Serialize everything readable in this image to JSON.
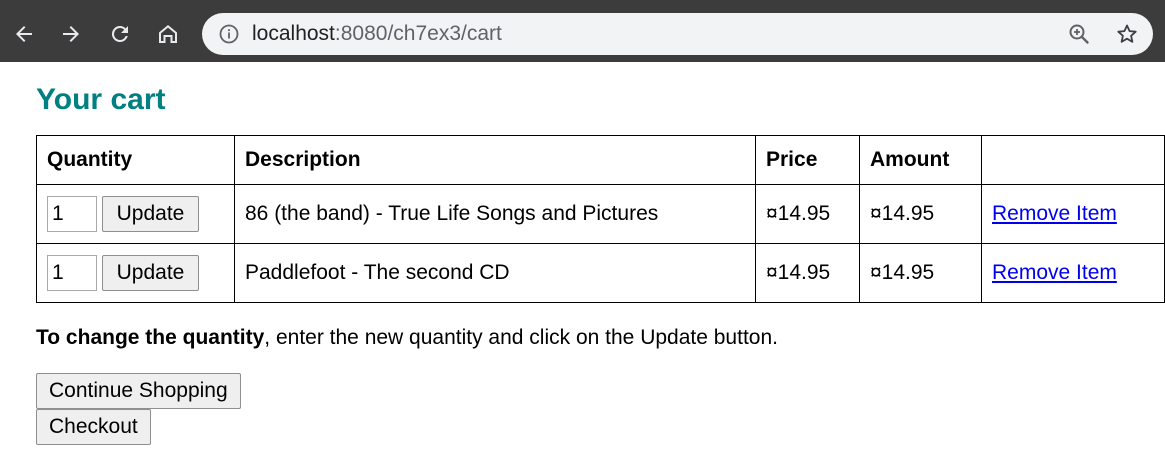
{
  "browser": {
    "url_host": "localhost",
    "url_path": ":8080/ch7ex3/cart",
    "icons": {
      "back": "back-arrow-icon",
      "forward": "forward-arrow-icon",
      "reload": "reload-icon",
      "home": "home-icon",
      "info": "info-icon",
      "zoom": "zoom-icon",
      "bookmark": "star-icon"
    }
  },
  "page": {
    "title": "Your cart",
    "title_color": "#008080"
  },
  "cart": {
    "headers": {
      "quantity": "Quantity",
      "description": "Description",
      "price": "Price",
      "amount": "Amount"
    },
    "items": [
      {
        "quantity": "1",
        "update_label": "Update",
        "description": "86 (the band) - True Life Songs and Pictures",
        "price": "¤14.95",
        "amount": "¤14.95",
        "remove_label": "Remove Item"
      },
      {
        "quantity": "1",
        "update_label": "Update",
        "description": "Paddlefoot - The second CD",
        "price": "¤14.95",
        "amount": "¤14.95",
        "remove_label": "Remove Item"
      }
    ]
  },
  "help": {
    "bold": "To change the quantity",
    "rest": ", enter the new quantity and click on the Update button."
  },
  "actions": {
    "continue_label": "Continue Shopping",
    "checkout_label": "Checkout"
  }
}
